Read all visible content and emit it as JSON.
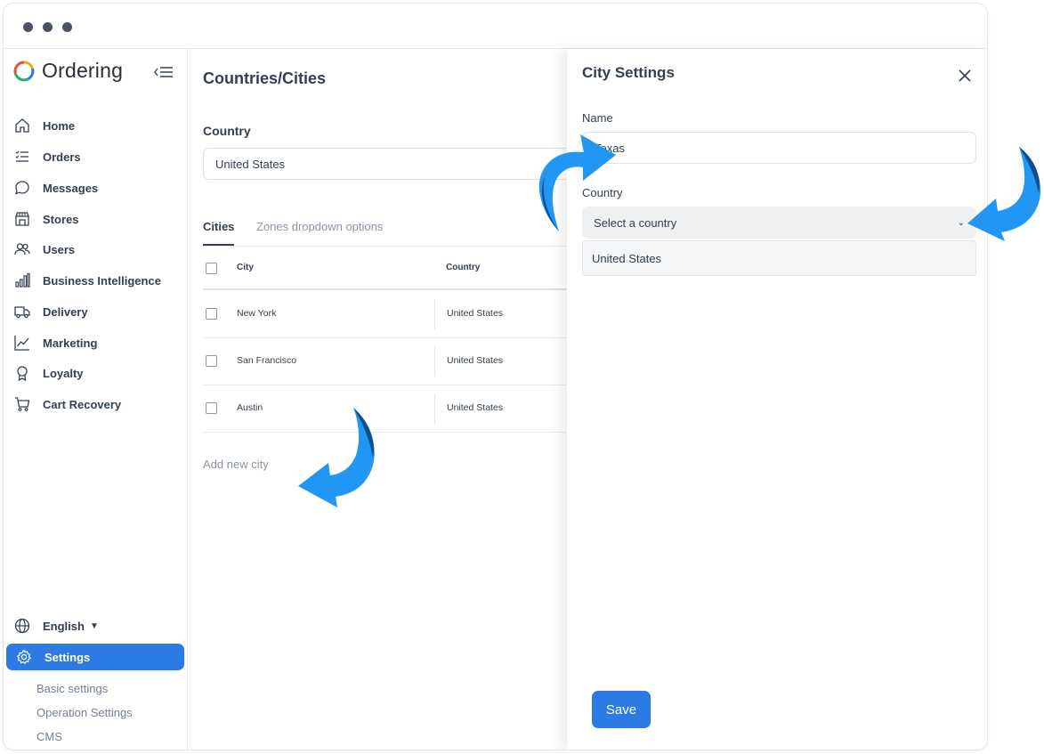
{
  "app": {
    "name": "Ordering"
  },
  "sidebar": {
    "items": [
      {
        "label": "Home",
        "icon": "home-icon"
      },
      {
        "label": "Orders",
        "icon": "orders-icon"
      },
      {
        "label": "Messages",
        "icon": "messages-icon"
      },
      {
        "label": "Stores",
        "icon": "stores-icon"
      },
      {
        "label": "Users",
        "icon": "users-icon"
      },
      {
        "label": "Business Intelligence",
        "icon": "bar-chart-icon"
      },
      {
        "label": "Delivery",
        "icon": "truck-icon"
      },
      {
        "label": "Marketing",
        "icon": "line-chart-icon"
      },
      {
        "label": "Loyalty",
        "icon": "award-icon"
      },
      {
        "label": "Cart Recovery",
        "icon": "cart-icon"
      }
    ],
    "language": "English",
    "settings_label": "Settings",
    "settings_subitems": [
      "Basic settings",
      "Operation Settings",
      "CMS"
    ]
  },
  "main": {
    "title": "Countries/Cities",
    "country_label": "Country",
    "country_value": "United States",
    "tabs": [
      {
        "label": "Cities",
        "active": true
      },
      {
        "label": "Zones dropdown options",
        "active": false
      }
    ],
    "table": {
      "headers": {
        "city": "City",
        "country": "Country"
      },
      "rows": [
        {
          "city": "New York",
          "country": "United States"
        },
        {
          "city": "San Francisco",
          "country": "United States"
        },
        {
          "city": "Austin",
          "country": "United States"
        }
      ]
    },
    "add_city_label": "Add new city"
  },
  "panel": {
    "title": "City Settings",
    "name_label": "Name",
    "name_value": "Texas",
    "country_label": "Country",
    "country_placeholder": "Select a country",
    "country_options": [
      "United States"
    ],
    "save_label": "Save"
  },
  "colors": {
    "accent": "#2c7be5",
    "arrow_light": "#2196f3",
    "arrow_dark": "#0d4f8b",
    "text": "#344050",
    "muted": "#8a94a6"
  }
}
